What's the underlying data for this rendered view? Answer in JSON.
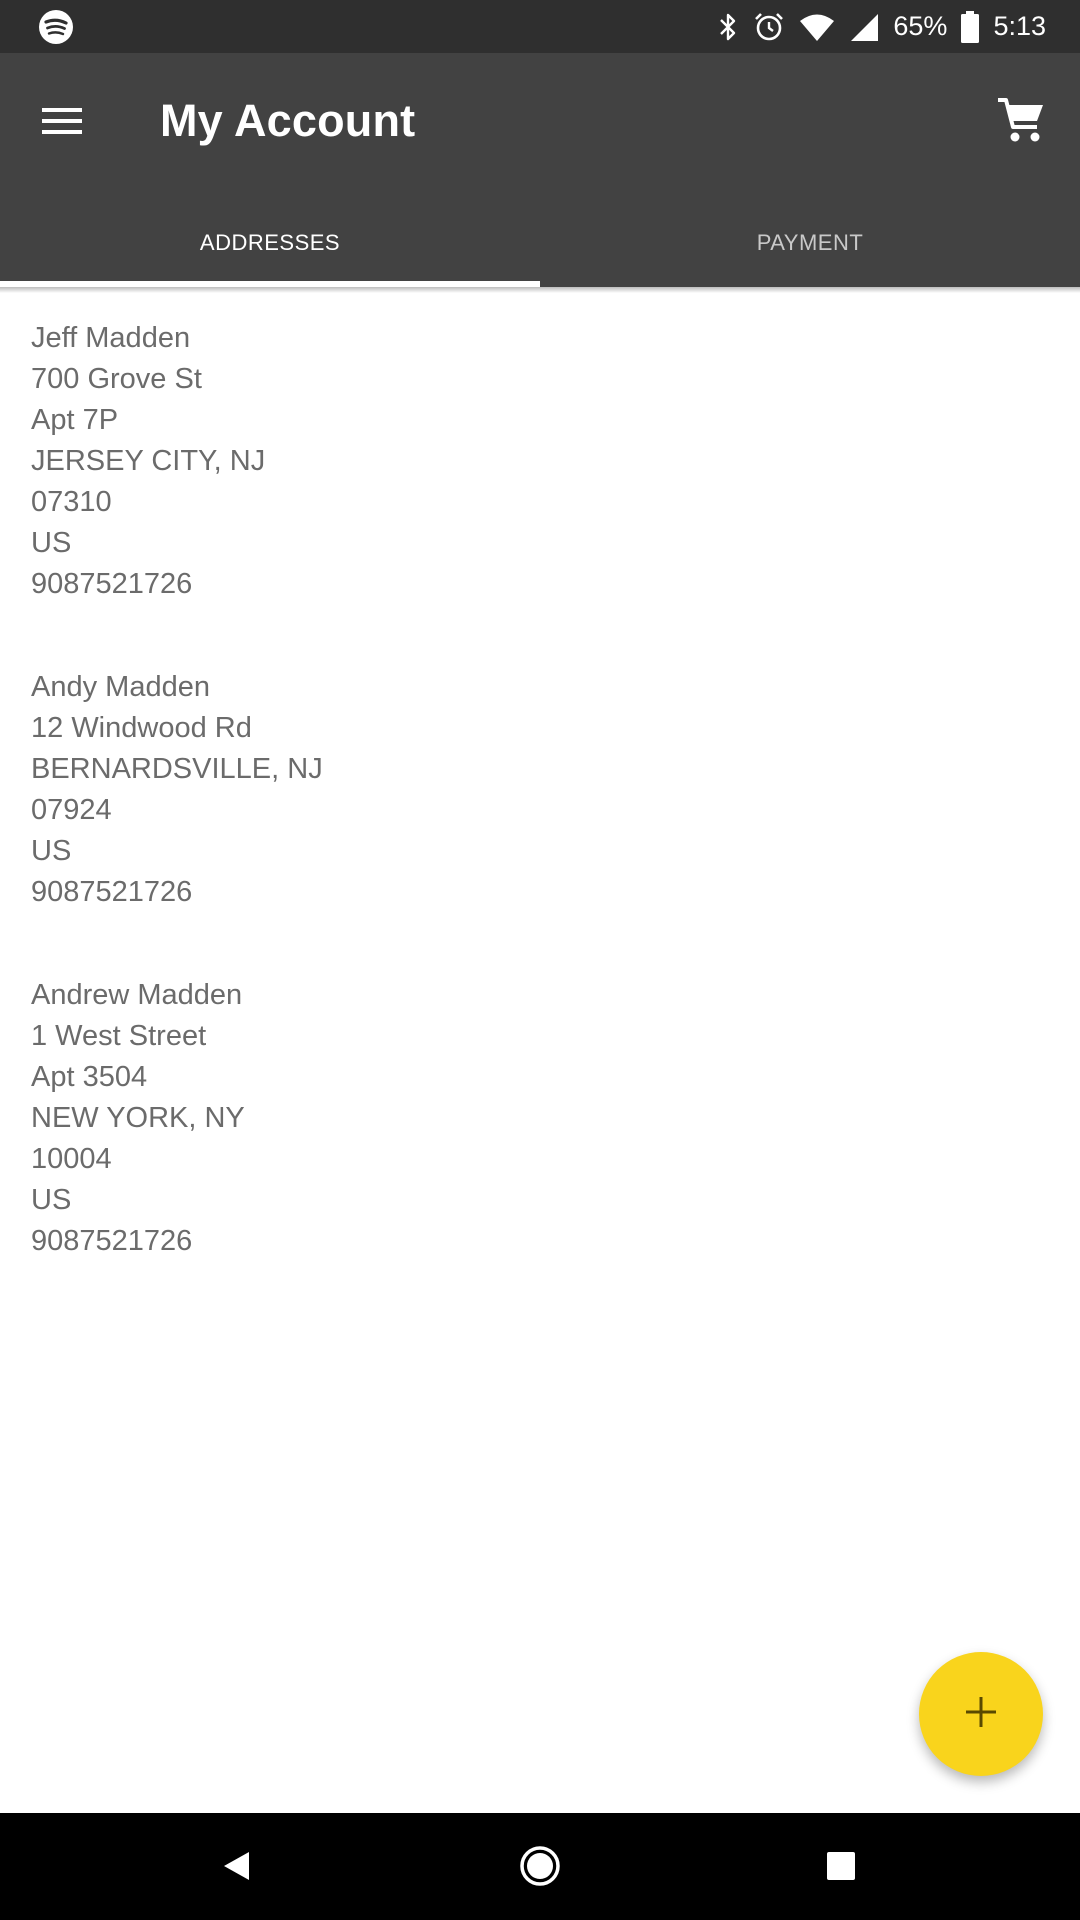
{
  "status_bar": {
    "battery": "65%",
    "time": "5:13"
  },
  "header": {
    "title": "My Account"
  },
  "tabs": [
    {
      "label": "ADDRESSES",
      "active": true
    },
    {
      "label": "PAYMENT",
      "active": false
    }
  ],
  "addresses": [
    {
      "name": "Jeff Madden",
      "street": "700 Grove St",
      "unit": "Apt 7P",
      "city_state": "JERSEY CITY, NJ",
      "zip": "07310",
      "country": "US",
      "phone": "9087521726"
    },
    {
      "name": "Andy Madden",
      "street": "12 Windwood Rd",
      "city_state": "BERNARDSVILLE, NJ",
      "zip": "07924",
      "country": "US",
      "phone": "9087521726"
    },
    {
      "name": "Andrew Madden",
      "street": "1 West Street",
      "unit": "Apt 3504",
      "city_state": "NEW YORK, NY",
      "zip": "10004",
      "country": "US",
      "phone": "9087521726"
    }
  ],
  "colors": {
    "status_bar": "#2f2f2f",
    "app_bar": "#424242",
    "fab": "#f9d41c",
    "address_text": "#6b6b6b"
  },
  "icons": {
    "status_left": "spotify-icon",
    "menu": "hamburger-menu-icon",
    "cart": "shopping-cart-icon",
    "fab": "plus-icon",
    "nav_back": "back-triangle-icon",
    "nav_home": "home-circle-icon",
    "nav_recents": "recents-square-icon"
  }
}
